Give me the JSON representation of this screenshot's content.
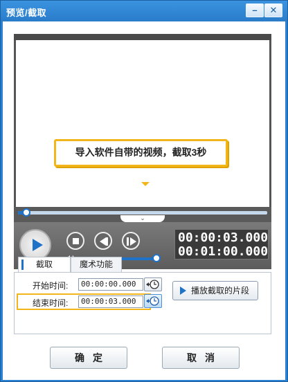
{
  "window": {
    "title": "预览/截取",
    "minimize_symbol": "–",
    "close_symbol": "✕"
  },
  "video": {
    "tip_text": "导入软件自带的视频，截取3秒",
    "fold_symbol": "⌄",
    "seek_progress": 0.03,
    "volume_level": 0.93,
    "current_time": "00:00:03.000",
    "total_time": "00:01:00.000"
  },
  "tabs": [
    {
      "label": "截取",
      "active": true
    },
    {
      "label": "魔术功能",
      "active": false
    }
  ],
  "clip": {
    "start_label": "开始时间:",
    "start_value": "00:00:00.000",
    "end_label": "结束时间:",
    "end_value": "00:00:03.000",
    "play_segment_label": "播放截取的片段"
  },
  "footer": {
    "ok_label": "确定",
    "cancel_label": "取消"
  },
  "colors": {
    "accent": "#1e73c9",
    "highlight": "#f2b51a",
    "titlebar": "#2c82d2"
  }
}
